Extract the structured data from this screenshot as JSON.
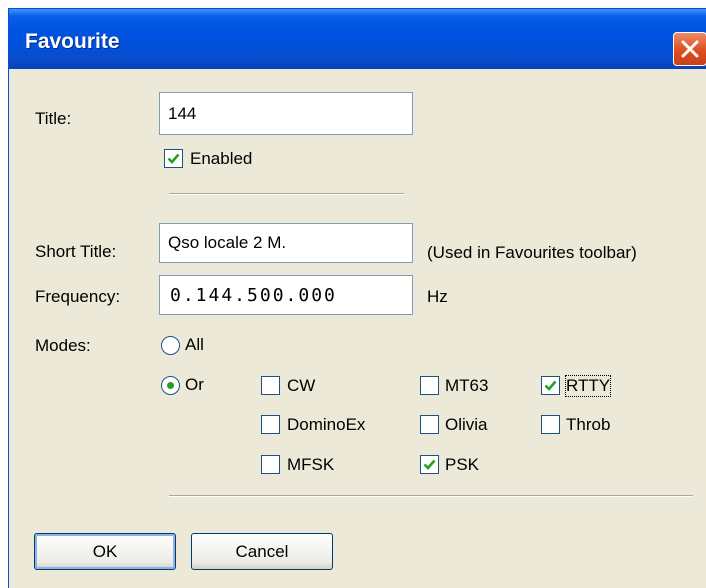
{
  "window": {
    "title": "Favourite"
  },
  "labels": {
    "title": "Title:",
    "short_title": "Short Title:",
    "frequency": "Frequency:",
    "modes": "Modes:"
  },
  "fields": {
    "title_value": "144",
    "short_title_value": "Qso locale 2 M.",
    "short_title_hint": "(Used in Favourites toolbar)",
    "frequency_value": "0.144.500.000",
    "frequency_unit": "Hz"
  },
  "enabled": {
    "label": "Enabled",
    "checked": true
  },
  "modes": {
    "all_label": "All",
    "or_label": "Or",
    "selected_radio": "Or",
    "options": [
      {
        "label": "CW",
        "checked": false
      },
      {
        "label": "MT63",
        "checked": false
      },
      {
        "label": "RTTY",
        "checked": true
      },
      {
        "label": "DominoEx",
        "checked": false
      },
      {
        "label": "Olivia",
        "checked": false
      },
      {
        "label": "Throb",
        "checked": false
      },
      {
        "label": "MFSK",
        "checked": false
      },
      {
        "label": "PSK",
        "checked": true
      }
    ]
  },
  "buttons": {
    "ok": "OK",
    "cancel": "Cancel"
  },
  "colors": {
    "titlebar": "#0054e3",
    "face": "#ece9d8",
    "check": "#21a121",
    "close": "#dd4e21"
  }
}
